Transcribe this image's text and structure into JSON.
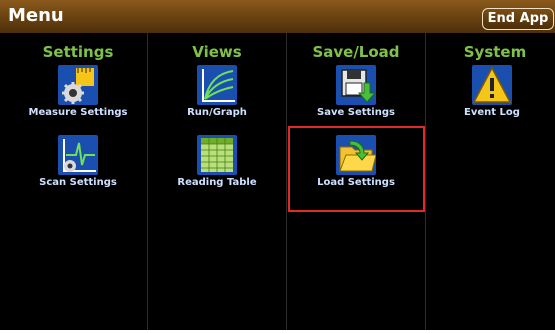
{
  "header": {
    "title": "Menu",
    "end_app_label": "End App"
  },
  "columns": [
    {
      "header": "Settings",
      "items": [
        {
          "label": "Measure Settings",
          "icon": "measure-settings-icon"
        },
        {
          "label": "Scan Settings",
          "icon": "scan-settings-icon"
        }
      ]
    },
    {
      "header": "Views",
      "items": [
        {
          "label": "Run/Graph",
          "icon": "run-graph-icon"
        },
        {
          "label": "Reading Table",
          "icon": "reading-table-icon"
        }
      ]
    },
    {
      "header": "Save/Load",
      "items": [
        {
          "label": "Save Settings",
          "icon": "save-settings-icon"
        },
        {
          "label": "Load Settings",
          "icon": "load-settings-icon"
        }
      ]
    },
    {
      "header": "System",
      "items": [
        {
          "label": "Event Log",
          "icon": "event-log-icon"
        }
      ]
    }
  ],
  "colors": {
    "header_green": "#7fc24a",
    "highlight_red": "#e02a2a",
    "label_blue": "#cfe0ff"
  }
}
